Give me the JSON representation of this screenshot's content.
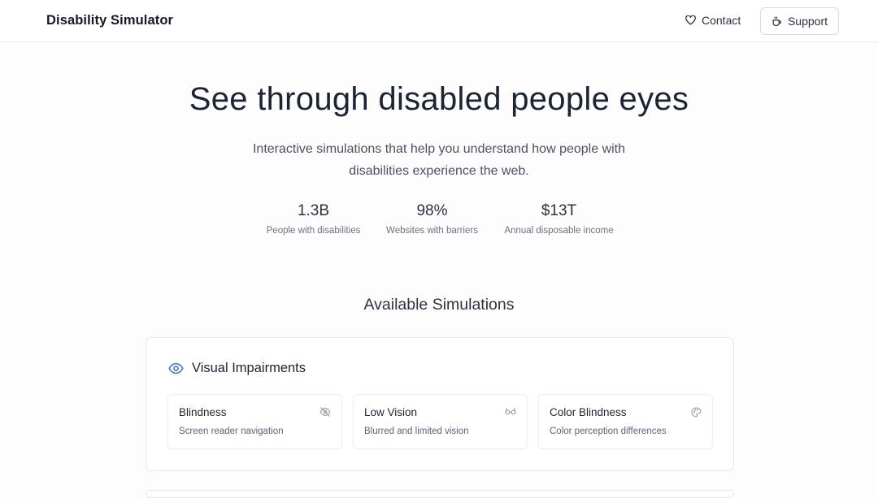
{
  "header": {
    "brand": "Disability Simulator",
    "contact_label": "Contact",
    "support_label": "Support"
  },
  "hero": {
    "title": "See through disabled people eyes",
    "subtitle_line1": "Interactive simulations that help you understand how people with",
    "subtitle_line2": "disabilities experience the web."
  },
  "stats": [
    {
      "value": "1.3B",
      "label": "People with disabilities"
    },
    {
      "value": "98%",
      "label": "Websites with barriers"
    },
    {
      "value": "$13T",
      "label": "Annual disposable income"
    }
  ],
  "simulations": {
    "section_title": "Available Simulations",
    "categories": [
      {
        "title": "Visual Impairments",
        "icon": "eye-icon",
        "items": [
          {
            "title": "Blindness",
            "description": "Screen reader navigation",
            "icon": "eye-off-icon"
          },
          {
            "title": "Low Vision",
            "description": "Blurred and limited vision",
            "icon": "glasses-icon"
          },
          {
            "title": "Color Blindness",
            "description": "Color perception differences",
            "icon": "palette-icon"
          }
        ]
      }
    ]
  },
  "colors": {
    "accent": "#4a7fd4",
    "text": "#1c2433",
    "muted": "#6b7280",
    "border": "#e6e7ea"
  }
}
